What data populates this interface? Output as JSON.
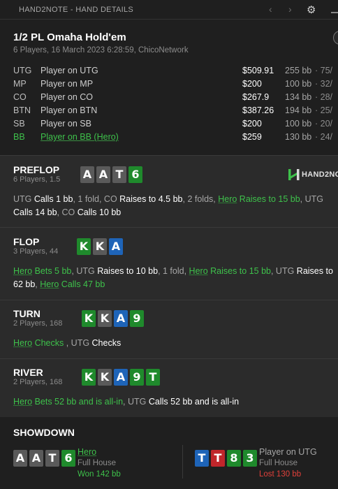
{
  "titlebar": {
    "title": "HAND2NOTE - HAND DETAILS",
    "back_icon": "chevron-left-icon",
    "forward_icon": "chevron-right-icon",
    "settings_icon": "gear-icon"
  },
  "game": {
    "title": "1/2 PL Omaha Hold'em",
    "subtitle": "6 Players, 16 March 2023 6:28:59, ChicoNetwork"
  },
  "players": [
    {
      "pos": "UTG",
      "name": "Player on UTG",
      "stack": "$509.91",
      "bb": "255 bb",
      "pct": "·  75/"
    },
    {
      "pos": "MP",
      "name": "Player on MP",
      "stack": "$200",
      "bb": "100 bb",
      "pct": "·  32/"
    },
    {
      "pos": "CO",
      "name": "Player on CO",
      "stack": "$267.9",
      "bb": "134 bb",
      "pct": "·  28/"
    },
    {
      "pos": "BTN",
      "name": "Player on BTN",
      "stack": "$387.26",
      "bb": "194 bb",
      "pct": "·  25/"
    },
    {
      "pos": "SB",
      "name": "Player on SB",
      "stack": "$200",
      "bb": "100 bb",
      "pct": "·  20/"
    },
    {
      "pos": "BB",
      "name": "Player on BB (Hero)",
      "stack": "$259",
      "bb": "130 bb",
      "pct": "·  24/",
      "hero": true
    }
  ],
  "logo": {
    "text": "HAND2NO"
  },
  "streets": {
    "preflop": {
      "name": "PREFLOP",
      "sub": "6 Players, 1.5",
      "cards": [
        {
          "r": "A",
          "s": "s"
        },
        {
          "r": "A",
          "s": "s"
        },
        {
          "r": "T",
          "s": "s"
        },
        {
          "r": "6",
          "s": "c"
        }
      ],
      "line1": [
        {
          "t": "UTG ",
          "c": "g"
        },
        {
          "t": "Calls 1 bb",
          "c": "w"
        },
        {
          "t": ", 1 fold, CO ",
          "c": "g"
        },
        {
          "t": "Raises to 4.5 bb",
          "c": "w"
        },
        {
          "t": ", 2 folds, ",
          "c": "g"
        },
        {
          "t": "Hero",
          "c": "hl"
        },
        {
          "t": " Raises to 15 bb",
          "c": "h"
        },
        {
          "t": ", UTG",
          "c": "g"
        }
      ],
      "line2": [
        {
          "t": "Calls 14 bb",
          "c": "w"
        },
        {
          "t": ", CO ",
          "c": "g"
        },
        {
          "t": "Calls 10 bb",
          "c": "w"
        }
      ]
    },
    "flop": {
      "name": "FLOP",
      "sub": "3 Players, 44",
      "cards": [
        {
          "r": "K",
          "s": "c"
        },
        {
          "r": "K",
          "s": "s"
        },
        {
          "r": "A",
          "s": "d"
        }
      ],
      "line1": [
        {
          "t": "Hero",
          "c": "hl"
        },
        {
          "t": " Bets 5 bb",
          "c": "h"
        },
        {
          "t": ", UTG ",
          "c": "g"
        },
        {
          "t": "Raises to 10 bb",
          "c": "w"
        },
        {
          "t": ", 1 fold, ",
          "c": "g"
        },
        {
          "t": "Hero",
          "c": "hl"
        },
        {
          "t": " Raises to 15 bb",
          "c": "h"
        },
        {
          "t": ", UTG ",
          "c": "g"
        },
        {
          "t": "Raises to",
          "c": "w"
        }
      ],
      "line2": [
        {
          "t": "62 bb",
          "c": "w"
        },
        {
          "t": ", ",
          "c": "g"
        },
        {
          "t": "Hero",
          "c": "hl"
        },
        {
          "t": " Calls 47 bb",
          "c": "h"
        }
      ]
    },
    "turn": {
      "name": "TURN",
      "sub": "2 Players, 168",
      "cards": [
        {
          "r": "K",
          "s": "c"
        },
        {
          "r": "K",
          "s": "s"
        },
        {
          "r": "A",
          "s": "d"
        },
        {
          "r": "9",
          "s": "c"
        }
      ],
      "line1": [
        {
          "t": "Hero",
          "c": "hl"
        },
        {
          "t": " Checks",
          "c": "h"
        },
        {
          "t": " , UTG ",
          "c": "g"
        },
        {
          "t": "Checks",
          "c": "w"
        }
      ]
    },
    "river": {
      "name": "RIVER",
      "sub": "2 Players, 168",
      "cards": [
        {
          "r": "K",
          "s": "c"
        },
        {
          "r": "K",
          "s": "s"
        },
        {
          "r": "A",
          "s": "d"
        },
        {
          "r": "9",
          "s": "c"
        },
        {
          "r": "T",
          "s": "c"
        }
      ],
      "line1": [
        {
          "t": "Hero",
          "c": "hl"
        },
        {
          "t": " Bets 52 bb and is all-in",
          "c": "h"
        },
        {
          "t": ", UTG ",
          "c": "g"
        },
        {
          "t": "Calls 52 bb and is all-in",
          "c": "w"
        }
      ]
    }
  },
  "showdown": {
    "title": "SHOWDOWN",
    "left": {
      "cards": [
        {
          "r": "A",
          "s": "s"
        },
        {
          "r": "A",
          "s": "s"
        },
        {
          "r": "T",
          "s": "s"
        },
        {
          "r": "6",
          "s": "c"
        }
      ],
      "name": "Hero",
      "hand": "Full House",
      "result": "Won 142 bb"
    },
    "right": {
      "cards": [
        {
          "r": "T",
          "s": "d"
        },
        {
          "r": "T",
          "s": "h"
        },
        {
          "r": "8",
          "s": "c"
        },
        {
          "r": "3",
          "s": "c"
        }
      ],
      "name": "Player on UTG",
      "hand": "Full House",
      "result": "Lost 130 bb"
    }
  },
  "colors": {
    "hero_green": "#3ec14b",
    "card_spade": "#5a5a5a",
    "card_club": "#1f8a2c",
    "card_diamond": "#1e64b8",
    "card_heart": "#c0262b",
    "won": "#3ec14b",
    "lost": "#e0403a"
  }
}
